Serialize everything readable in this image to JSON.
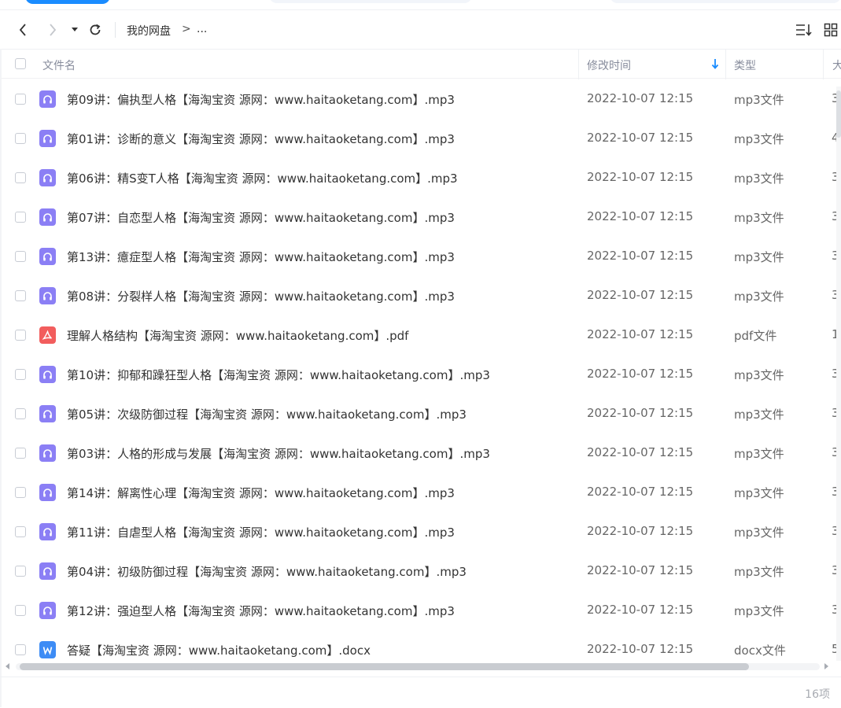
{
  "nav": {
    "breadcrumb_root": "我的网盘",
    "breadcrumb_separator": ">",
    "breadcrumb_more": "..."
  },
  "header": {
    "name": "文件名",
    "modified": "修改时间",
    "type": "类型",
    "size": "大"
  },
  "files": [
    {
      "name": "第09讲：偏执型人格【海淘宝资 源网：www.haitaoketang.com】.mp3",
      "date": "2022-10-07 12:15",
      "type": "mp3文件",
      "size": "3",
      "icon": "mp3"
    },
    {
      "name": "第01讲：诊断的意义【海淘宝资 源网：www.haitaoketang.com】.mp3",
      "date": "2022-10-07 12:15",
      "type": "mp3文件",
      "size": "4",
      "icon": "mp3"
    },
    {
      "name": "第06讲：精S变T人格【海淘宝资 源网：www.haitaoketang.com】.mp3",
      "date": "2022-10-07 12:15",
      "type": "mp3文件",
      "size": "3",
      "icon": "mp3"
    },
    {
      "name": "第07讲：自恋型人格【海淘宝资 源网：www.haitaoketang.com】.mp3",
      "date": "2022-10-07 12:15",
      "type": "mp3文件",
      "size": "3",
      "icon": "mp3"
    },
    {
      "name": "第13讲：癔症型人格【海淘宝资 源网：www.haitaoketang.com】.mp3",
      "date": "2022-10-07 12:15",
      "type": "mp3文件",
      "size": "3",
      "icon": "mp3"
    },
    {
      "name": "第08讲：分裂样人格【海淘宝资 源网：www.haitaoketang.com】.mp3",
      "date": "2022-10-07 12:15",
      "type": "mp3文件",
      "size": "3",
      "icon": "mp3"
    },
    {
      "name": "理解人格结构【海淘宝资 源网：www.haitaoketang.com】.pdf",
      "date": "2022-10-07 12:15",
      "type": "pdf文件",
      "size": "1",
      "icon": "pdf"
    },
    {
      "name": "第10讲：抑郁和躁狂型人格【海淘宝资 源网：www.haitaoketang.com】.mp3",
      "date": "2022-10-07 12:15",
      "type": "mp3文件",
      "size": "3",
      "icon": "mp3"
    },
    {
      "name": "第05讲：次级防御过程【海淘宝资 源网：www.haitaoketang.com】.mp3",
      "date": "2022-10-07 12:15",
      "type": "mp3文件",
      "size": "3",
      "icon": "mp3"
    },
    {
      "name": "第03讲：人格的形成与发展【海淘宝资 源网：www.haitaoketang.com】.mp3",
      "date": "2022-10-07 12:15",
      "type": "mp3文件",
      "size": "3",
      "icon": "mp3"
    },
    {
      "name": "第14讲：解离性心理【海淘宝资 源网：www.haitaoketang.com】.mp3",
      "date": "2022-10-07 12:15",
      "type": "mp3文件",
      "size": "3",
      "icon": "mp3"
    },
    {
      "name": "第11讲：自虐型人格【海淘宝资 源网：www.haitaoketang.com】.mp3",
      "date": "2022-10-07 12:15",
      "type": "mp3文件",
      "size": "3",
      "icon": "mp3"
    },
    {
      "name": "第04讲：初级防御过程【海淘宝资 源网：www.haitaoketang.com】.mp3",
      "date": "2022-10-07 12:15",
      "type": "mp3文件",
      "size": "3",
      "icon": "mp3"
    },
    {
      "name": "第12讲：强迫型人格【海淘宝资 源网：www.haitaoketang.com】.mp3",
      "date": "2022-10-07 12:15",
      "type": "mp3文件",
      "size": "3",
      "icon": "mp3"
    },
    {
      "name": "答疑【海淘宝资 源网：www.haitaoketang.com】.docx",
      "date": "2022-10-07 12:15",
      "type": "docx文件",
      "size": "5",
      "icon": "docx"
    }
  ],
  "footer": {
    "count": "16项"
  },
  "colors": {
    "accent": "#1a8cff",
    "mp3_icon": "#8b7ff5",
    "pdf_icon": "#f25d5d",
    "docx_icon": "#3d8cf5"
  }
}
